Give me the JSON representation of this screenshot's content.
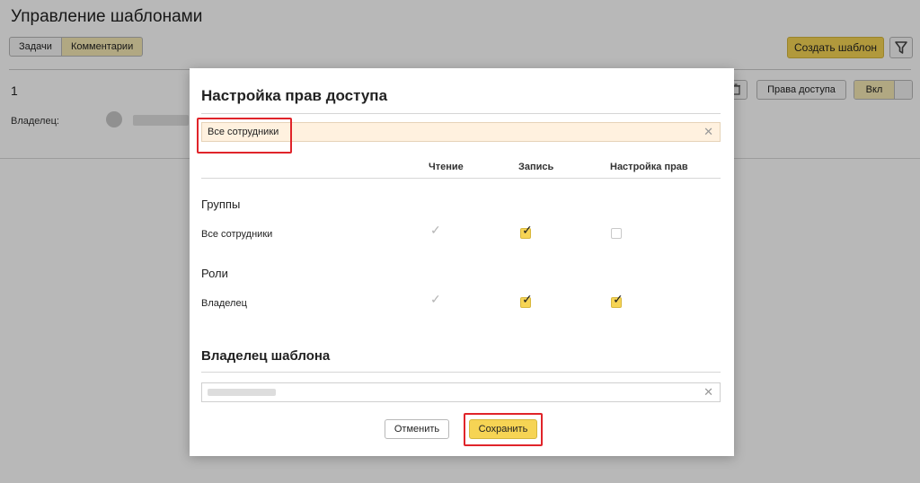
{
  "page": {
    "title": "Управление шаблонами",
    "tabs": [
      "Задачи",
      "Комментарии"
    ],
    "create_button": "Создать шаблон",
    "row": {
      "number": "1",
      "owner_label": "Владелец:",
      "access_button": "Права доступа",
      "toggle_label": "Вкл"
    }
  },
  "modal": {
    "title": "Настройка прав доступа",
    "selected_field_value": "Все сотрудники",
    "columns": [
      "Чтение",
      "Запись",
      "Настройка прав"
    ],
    "sections": [
      {
        "title": "Группы",
        "rows": [
          {
            "label": "Все сотрудники",
            "read": "checked-disabled",
            "write": "checked",
            "manage": "unchecked"
          }
        ]
      },
      {
        "title": "Роли",
        "rows": [
          {
            "label": "Владелец",
            "read": "checked-disabled",
            "write": "checked",
            "manage": "checked"
          }
        ]
      }
    ],
    "owner_title": "Владелец шаблона",
    "cancel_button": "Отменить",
    "save_button": "Сохранить"
  },
  "icons": {
    "filter": "filter-icon",
    "trash": "trash-icon",
    "clear": "close-icon",
    "check": "check-icon"
  },
  "colors": {
    "accent": "#f6d454",
    "active_tab": "#f6e9b4",
    "highlight_field": "#fff1df",
    "annotation": "#e0242a"
  }
}
